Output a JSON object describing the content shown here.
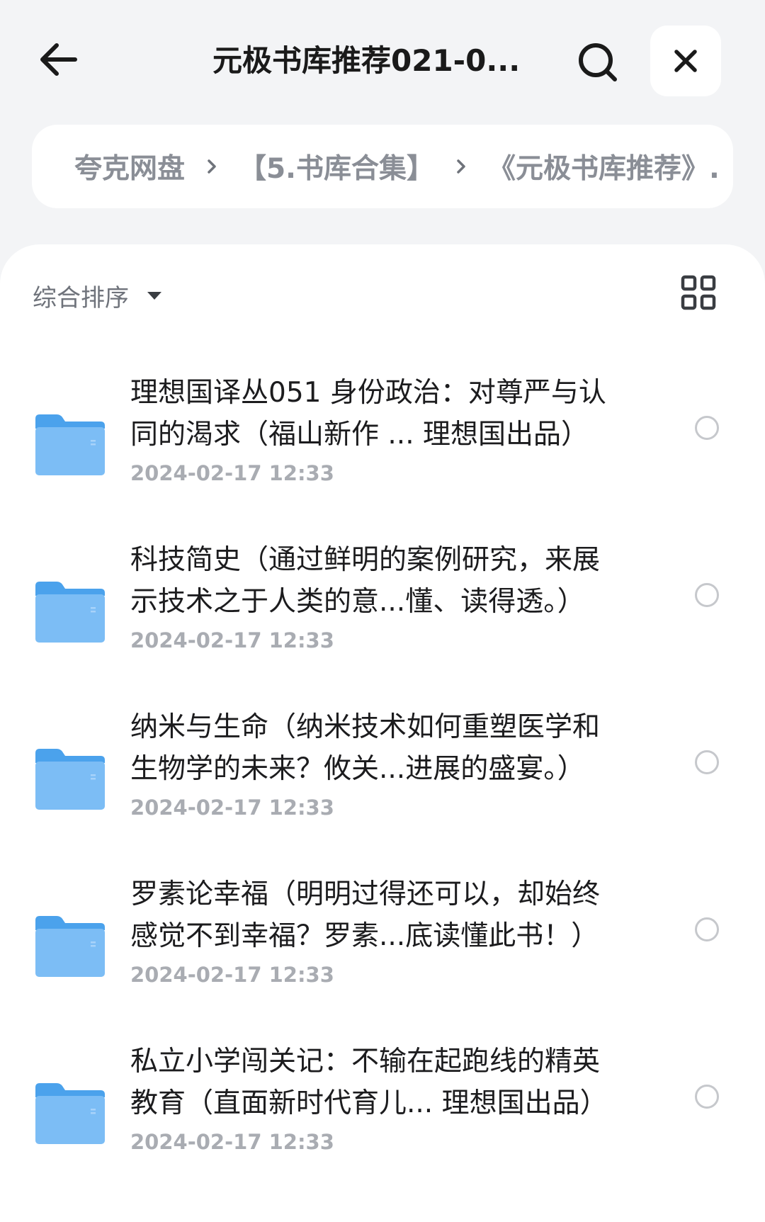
{
  "header": {
    "title": "元极书库推荐021-0...",
    "back_icon": "arrow-left-icon",
    "search_icon": "search-icon",
    "close_icon": "close-icon"
  },
  "breadcrumb": {
    "items": [
      "夸克网盘",
      "【5.书库合集】",
      "《元极书库推荐》."
    ]
  },
  "toolbar": {
    "sort_label": "综合排序",
    "view_icon": "grid-view-icon"
  },
  "files": [
    {
      "name": "理想国译丛051 身份政治：对尊严与认同的渴求（福山新作 ... 理想国出品）",
      "date": "2024-02-17 12:33"
    },
    {
      "name": "科技简史（通过鲜明的案例研究，来展示技术之于人类的意...懂、读得透。）",
      "date": "2024-02-17 12:33"
    },
    {
      "name": "纳米与生命（纳米技术如何重塑医学和生物学的未来？攸关...进展的盛宴。）",
      "date": "2024-02-17 12:33"
    },
    {
      "name": "罗素论幸福（明明过得还可以，却始终感觉不到幸福？罗素...底读懂此书！）",
      "date": "2024-02-17 12:33"
    },
    {
      "name": "私立小学闯关记：不输在起跑线的精英教育（直面新时代育儿... 理想国出品）",
      "date": "2024-02-17 12:33"
    }
  ],
  "colors": {
    "background": "#f3f4f6",
    "folder": "#6cb6f3",
    "secondary_text": "#8a8e96",
    "date_text": "#a9acb2"
  }
}
